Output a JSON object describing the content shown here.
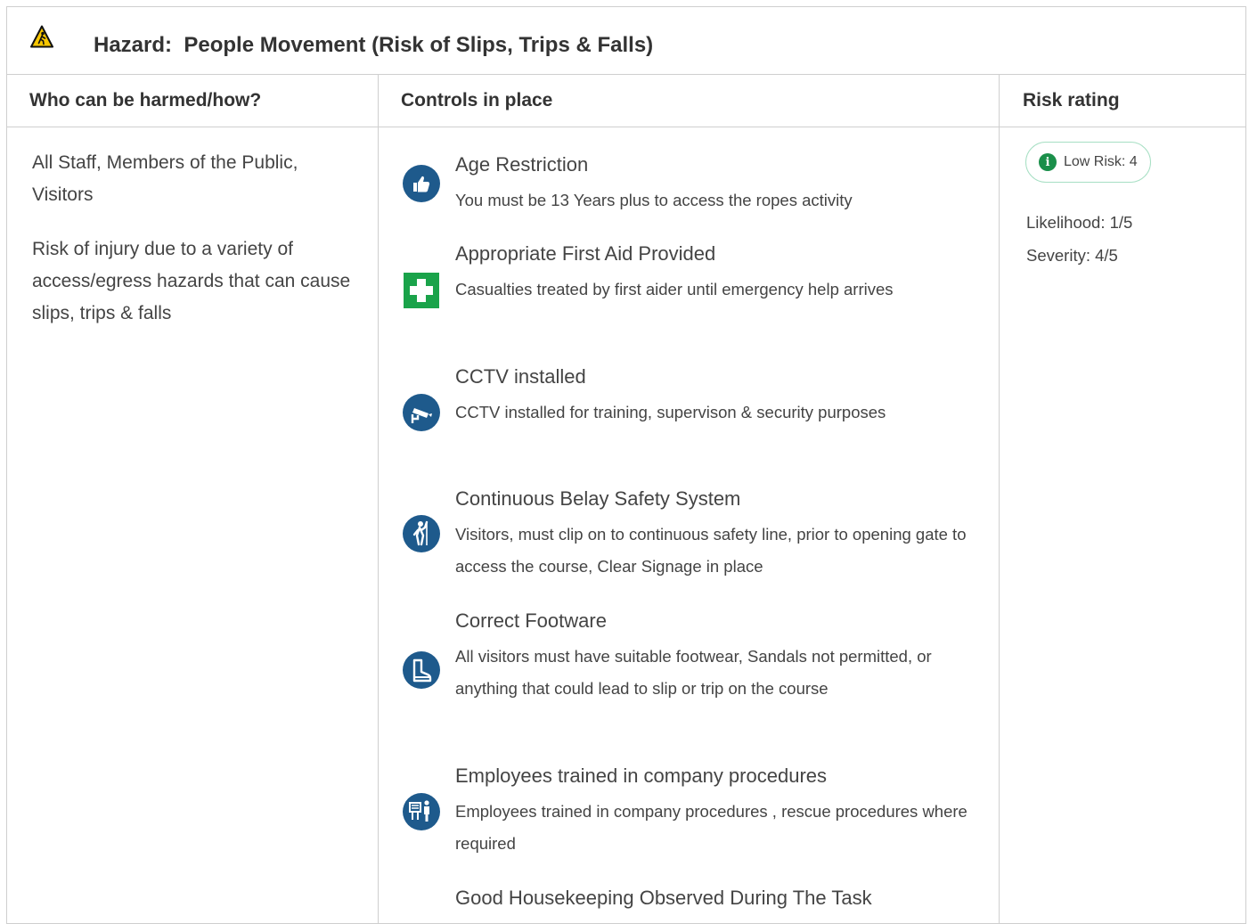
{
  "hazard": {
    "label": "Hazard:",
    "name": "People Movement (Risk of Slips, Trips & Falls)",
    "icon": "warning-pedestrian-icon"
  },
  "columns": {
    "who": "Who can be harmed/how?",
    "controls": "Controls in place",
    "risk": "Risk rating"
  },
  "who": {
    "groups": "All Staff, Members of the Public, Visitors",
    "description": "Risk of injury due to a variety of access/egress hazards that can cause slips, trips & falls"
  },
  "controls": [
    {
      "title": "Age Restriction",
      "description": "You must be 13 Years plus to access the ropes activity",
      "icon": "thumbs-up-icon",
      "color": "#1e5a8c"
    },
    {
      "title": "Appropriate First Aid Provided",
      "description": "Casualties treated by first aider until emergency help arrives",
      "icon": "first-aid-cross-icon",
      "color": "#1aa34a"
    },
    {
      "title": "CCTV installed",
      "description": "CCTV installed for training, supervison & security purposes",
      "icon": "cctv-camera-icon",
      "color": "#1e5a8c"
    },
    {
      "title": "Continuous Belay Safety System",
      "description": "Visitors, must clip on to continuous safety line, prior to opening gate to access the course, Clear Signage in place",
      "icon": "safety-harness-icon",
      "color": "#1e5a8c"
    },
    {
      "title": "Correct Footware",
      "description": "All visitors must have suitable footwear, Sandals not permitted, or anything that could lead to slip or trip on the course",
      "icon": "safety-boot-icon",
      "color": "#1e5a8c"
    },
    {
      "title": "Employees trained in company procedures",
      "description": "Employees trained in company procedures , rescue procedures where required",
      "icon": "training-board-icon",
      "color": "#1e5a8c"
    },
    {
      "title": "Good Housekeeping Observed During The Task",
      "description": "",
      "icon": "",
      "color": "#1e5a8c"
    }
  ],
  "risk": {
    "badge": "Low Risk: 4",
    "badge_icon": "info-icon",
    "badge_color": "#1a8f4a",
    "likelihood": "Likelihood: 1/5",
    "severity": "Severity: 4/5"
  }
}
